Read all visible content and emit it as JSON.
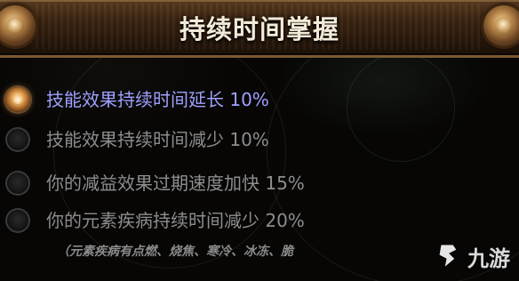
{
  "header": {
    "title": "持续时间掌握"
  },
  "options": [
    {
      "text": "技能效果持续时间延长 10%",
      "selected": true
    },
    {
      "text": "技能效果持续时间减少 10%",
      "selected": false
    },
    {
      "text": "你的减益效果过期速度加快 15%",
      "selected": false
    },
    {
      "text": "你的元素疾病持续时间减少 20%",
      "selected": false
    }
  ],
  "footnote": "（元素疾病有点燃、烧焦、寒冷、冰冻、脆",
  "watermark": {
    "text": "九游"
  },
  "colors": {
    "selected_text": "#9ea0ff",
    "unselected_text": "#8d8d8d",
    "header_bg": "#3b2412",
    "title_text": "#f3ead8"
  },
  "icons": {
    "ornament": "bronze-orb-icon",
    "radio_selected": "radio-selected-icon",
    "radio_unselected": "radio-unselected-icon",
    "watermark_logo": "nine-game-logo-icon"
  }
}
